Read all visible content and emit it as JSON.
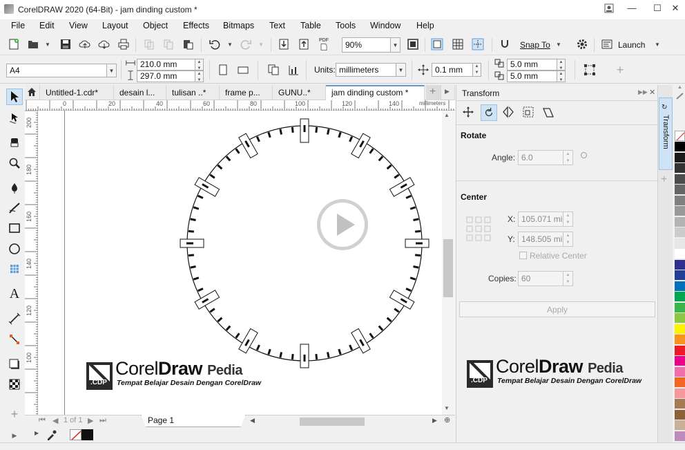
{
  "window": {
    "title": "CorelDRAW 2020 (64-Bit) - jam dinding custom *"
  },
  "menu": [
    "File",
    "Edit",
    "View",
    "Layout",
    "Object",
    "Effects",
    "Bitmaps",
    "Text",
    "Table",
    "Tools",
    "Window",
    "Help"
  ],
  "toolbar": {
    "zoom": "90%",
    "snap_label": "Snap To",
    "launch_label": "Launch",
    "pdf_label": "PDF"
  },
  "property_bar": {
    "page_size": "A4",
    "width": "210.0 mm",
    "height": "297.0 mm",
    "units_label": "Units:",
    "units_value": "millimeters",
    "nudge": "0.1 mm",
    "dup_x": "5.0 mm",
    "dup_y": "5.0 mm"
  },
  "doc_tabs": [
    {
      "label": "Untitled-1.cdr*",
      "active": false
    },
    {
      "label": "desain l...",
      "active": false
    },
    {
      "label": "tulisan ..*",
      "active": false
    },
    {
      "label": "frame p...",
      "active": false
    },
    {
      "label": "GUNU..*",
      "active": false
    },
    {
      "label": "jam dinding custom *",
      "active": true
    }
  ],
  "ruler": {
    "h_labels": [
      "0",
      "20",
      "40",
      "60",
      "80",
      "100",
      "120",
      "140"
    ],
    "h_units": "millimeters",
    "v_labels": [
      "200",
      "180",
      "160",
      "140",
      "120",
      "100"
    ]
  },
  "canvas": {
    "watermark_brand_1": "Corel",
    "watermark_brand_2": "Draw",
    "watermark_brand_3": "Pedia",
    "watermark_tagline": "Tempat Belajar Desain Dengan CorelDraw",
    "watermark_badge": ".CDP"
  },
  "status": {
    "page_counter": "1 of 1",
    "page_tab": "Page 1"
  },
  "docker": {
    "title": "Transform",
    "tab_label": "Transform",
    "rotate_heading": "Rotate",
    "angle_label": "Angle:",
    "angle_value": "6.0",
    "center_heading": "Center",
    "x_label": "X:",
    "x_value": "105.071 mi",
    "y_label": "Y:",
    "y_value": "148.505 mi",
    "relative_center_label": "Relative Center",
    "copies_label": "Copies:",
    "copies_value": "60",
    "apply_label": "Apply"
  },
  "palette": [
    "#000000",
    "#1a1a1a",
    "#333333",
    "#4d4d4d",
    "#666666",
    "#808080",
    "#999999",
    "#b3b3b3",
    "#cccccc",
    "#e6e6e6",
    "#ffffff",
    "#2e3192",
    "#21409a",
    "#0072bc",
    "#00a651",
    "#39b54a",
    "#8dc63f",
    "#fff200",
    "#f7941d",
    "#ed1c24",
    "#ec008c",
    "#f06eaa",
    "#f26522",
    "#f5989d",
    "#a67c52",
    "#8c6239",
    "#c7b299",
    "#bd8cbf"
  ]
}
